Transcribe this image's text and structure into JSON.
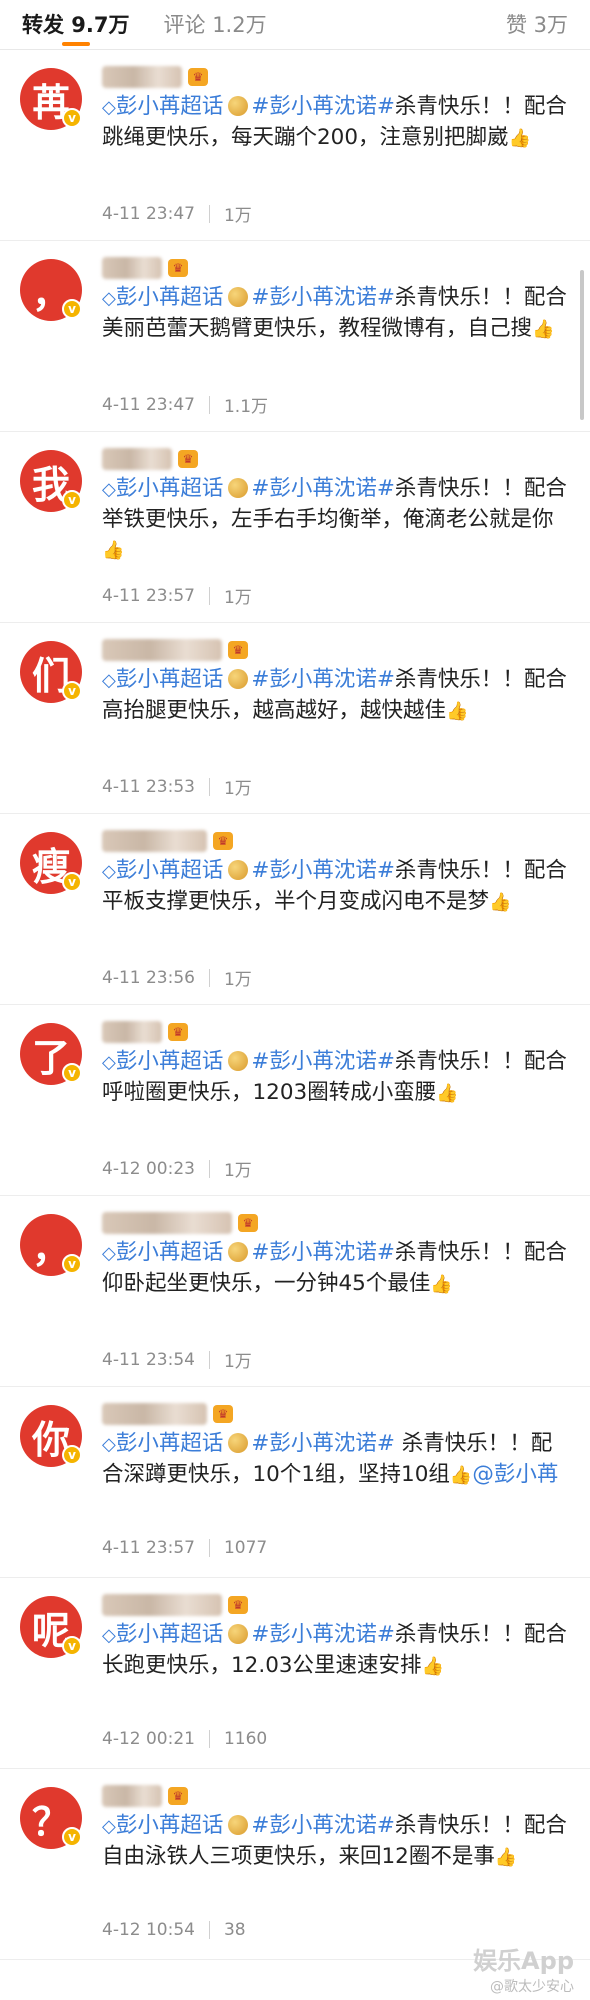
{
  "tabs": {
    "repost": "转发 9.7万",
    "comment": "评论 1.2万",
    "like": "赞 3万"
  },
  "icons": {
    "diamond": "◇",
    "verified": "v",
    "thumb": "👍",
    "crown": "♛"
  },
  "colors": {
    "accent": "#ff8200",
    "avatar_bg": "#e0392d",
    "link": "#3b7dd8"
  },
  "reposts": [
    {
      "avatar": "苒",
      "supertopic": "彭小苒超话",
      "hashtag": "#彭小苒沈诺#",
      "text": "杀青快乐！！配合跳绳更快乐，每天蹦个200，注意别把脚崴",
      "time": "4-11 23:47",
      "likes": "1万"
    },
    {
      "avatar": "，",
      "supertopic": "彭小苒超话",
      "hashtag": "#彭小苒沈诺#",
      "text": "杀青快乐！！配合美丽芭蕾天鹅臂更快乐，教程微博有，自己搜",
      "time": "4-11 23:47",
      "likes": "1.1万"
    },
    {
      "avatar": "我",
      "supertopic": "彭小苒超话",
      "hashtag": "#彭小苒沈诺#",
      "text": "杀青快乐！！配合举铁更快乐，左手右手均衡举，俺滴老公就是你",
      "time": "4-11 23:57",
      "likes": "1万"
    },
    {
      "avatar": "们",
      "supertopic": "彭小苒超话",
      "hashtag": "#彭小苒沈诺#",
      "text": "杀青快乐！！配合高抬腿更快乐，越高越好，越快越佳",
      "time": "4-11 23:53",
      "likes": "1万"
    },
    {
      "avatar": "瘦",
      "supertopic": "彭小苒超话",
      "hashtag": "#彭小苒沈诺#",
      "text": "杀青快乐！！配合平板支撑更快乐，半个月变成闪电不是梦",
      "time": "4-11 23:56",
      "likes": "1万"
    },
    {
      "avatar": "了",
      "supertopic": "彭小苒超话",
      "hashtag": "#彭小苒沈诺#",
      "text": "杀青快乐！！配合呼啦圈更快乐，1203圈转成小蛮腰",
      "time": "4-12 00:23",
      "likes": "1万"
    },
    {
      "avatar": "，",
      "supertopic": "彭小苒超话",
      "hashtag": "#彭小苒沈诺#",
      "text": "杀青快乐！！配合仰卧起坐更快乐，一分钟45个最佳",
      "time": "4-11 23:54",
      "likes": "1万"
    },
    {
      "avatar": "你",
      "supertopic": "彭小苒超话",
      "hashtag": "#彭小苒沈诺#",
      "text": " 杀青快乐！！配合深蹲更快乐，10个1组，坚持10组",
      "mention": "@彭小苒",
      "time": "4-11 23:57",
      "likes": "1077"
    },
    {
      "avatar": "呢",
      "supertopic": "彭小苒超话",
      "hashtag": "#彭小苒沈诺#",
      "text": "杀青快乐！！配合长跑更快乐，12.03公里速速安排",
      "time": "4-12 00:21",
      "likes": "1160"
    },
    {
      "avatar": "？",
      "supertopic": "彭小苒超话",
      "hashtag": "#彭小苒沈诺#",
      "text": "杀青快乐！！配合自由泳铁人三项更快乐，来回12圈不是事",
      "time": "4-12 10:54",
      "likes": "38"
    }
  ],
  "watermark": {
    "app": "娱乐App",
    "handle": "@歌太少安心"
  }
}
